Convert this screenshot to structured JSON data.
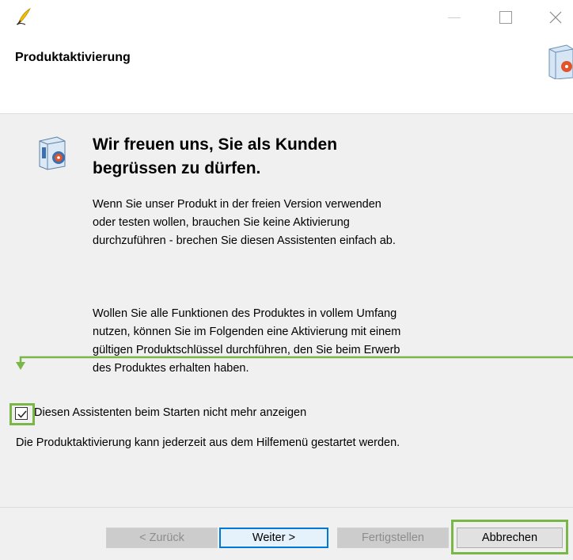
{
  "window": {
    "app_icon": "quill-pen-icon"
  },
  "header": {
    "title": "Produktaktivierung",
    "icon": "product-box-icon"
  },
  "main": {
    "heading": "Wir freuen uns, Sie als Kunden begrüssen zu dürfen.",
    "paragraph1": "Wenn Sie unser Produkt in der freien Version verwenden oder testen wollen, brauchen Sie keine Aktivierung durchzuführen - brechen Sie diesen Assistenten einfach ab.",
    "paragraph2": "Wollen Sie alle Funktionen des Produktes in vollem Umfang nutzen, können Sie im Folgenden eine Aktivierung mit einem gültigen Produktschlüssel durchführen, den Sie beim Erwerb des Produktes erhalten haben.",
    "checkbox_label": "Diesen Assistenten beim Starten nicht mehr anzeigen",
    "checkbox_checked": true,
    "info_text": "Die Produktaktivierung kann jederzeit aus dem Hilfemenü gestartet werden."
  },
  "buttons": {
    "back": "< Zurück",
    "next": "Weiter >",
    "finish": "Fertigstellen",
    "cancel": "Abbrechen"
  },
  "colors": {
    "highlight": "#7ab648",
    "focus": "#0078d7"
  }
}
